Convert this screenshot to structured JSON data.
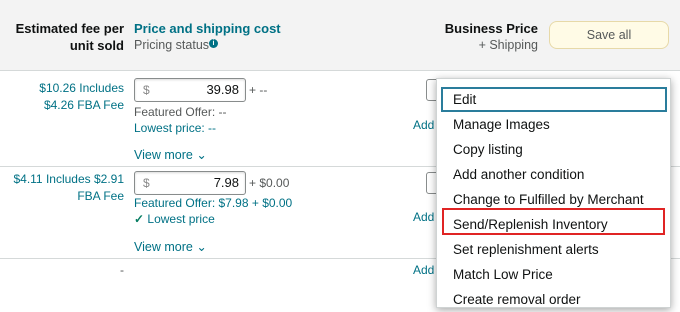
{
  "header": {
    "fee_line1": "Estimated fee per",
    "fee_line2": "unit sold",
    "price_title": "Price and shipping cost",
    "pricing_status": "Pricing status",
    "info_icon_glyph": "i",
    "business_price": "Business Price",
    "plus_shipping": "+ Shipping",
    "save_all": "Save all"
  },
  "rows": [
    {
      "fee_line1": "$10.26 Includes",
      "fee_line2": "$4.26 FBA Fee",
      "currency": "$",
      "price": "39.98",
      "shipping": "+ --",
      "featured_offer": "Featured Offer: --",
      "lowest_price": "Lowest price: --",
      "view_more": "View more",
      "add_label": "Add"
    },
    {
      "fee_line1": "$4.11 Includes $2.91",
      "fee_line2": "FBA Fee",
      "currency": "$",
      "price": "7.98",
      "shipping": "+ $0.00",
      "featured_offer": "Featured Offer: $7.98 + $0.00",
      "lowest_price": "Lowest price",
      "check_glyph": "✓",
      "view_more": "View more",
      "add_label": "Add"
    },
    {
      "fee": "-",
      "add_label": "Add"
    }
  ],
  "menu": {
    "items": [
      "Edit",
      "Manage Images",
      "Copy listing",
      "Add another condition",
      "Change to Fulfilled by Merchant",
      "Send/Replenish Inventory",
      "Set replenishment alerts",
      "Match Low Price",
      "Create removal order"
    ],
    "selected_index": 0,
    "highlighted_index": 5
  },
  "chevron_glyph": "⌄",
  "colors": {
    "link": "#007185",
    "highlight_border": "#e02424",
    "success": "#067d62",
    "save_button_bg": "#fffbe6"
  }
}
